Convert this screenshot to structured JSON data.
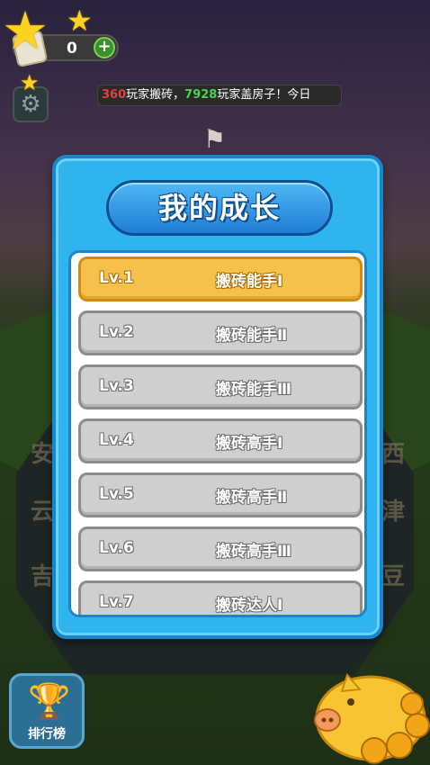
{
  "hud": {
    "coin_value": "0",
    "plus_label": "+",
    "ticker": {
      "count1": "360",
      "text1": "玩家搬砖，",
      "count2": "7928",
      "text2": "玩家盖房子！今日"
    }
  },
  "background": {
    "cities": [
      "安",
      "西",
      "云",
      "津",
      "吉",
      "豆"
    ]
  },
  "modal": {
    "title": "我的成长",
    "levels": [
      {
        "level": "Lv.1",
        "name": "搬砖能手Ⅰ",
        "active": true
      },
      {
        "level": "Lv.2",
        "name": "搬砖能手Ⅱ",
        "active": false
      },
      {
        "level": "Lv.3",
        "name": "搬砖能手Ⅲ",
        "active": false
      },
      {
        "level": "Lv.4",
        "name": "搬砖高手Ⅰ",
        "active": false
      },
      {
        "level": "Lv.5",
        "name": "搬砖高手Ⅱ",
        "active": false
      },
      {
        "level": "Lv.6",
        "name": "搬砖高手Ⅲ",
        "active": false
      },
      {
        "level": "Lv.7",
        "name": "搬砖达人Ⅰ",
        "active": false
      }
    ]
  },
  "leaderboard": {
    "label": "排行榜"
  },
  "colors": {
    "modal_bg": "#2fb4ee",
    "active_row": "#f6c14a",
    "inactive_row": "#cfcfcf"
  }
}
